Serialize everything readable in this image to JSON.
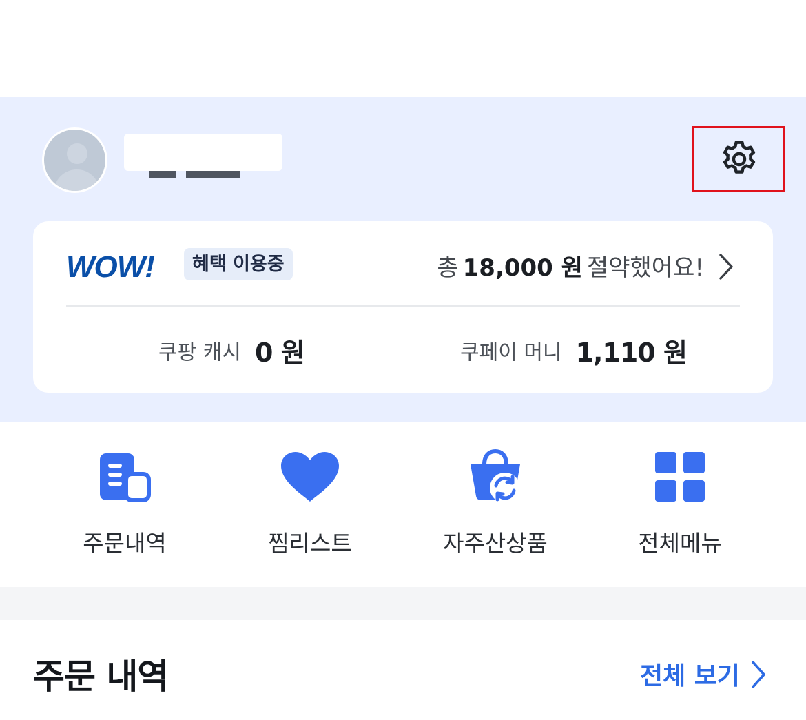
{
  "profile": {
    "avatar_icon": "user-avatar-placeholder"
  },
  "settings": {
    "icon": "gear-icon"
  },
  "membership": {
    "logo_text": "WOW!",
    "badge": "혜택 이용중",
    "savings_prefix": "총",
    "savings_amount": "18,000 원",
    "savings_suffix": "절약했어요!"
  },
  "wallet": {
    "cash_label": "쿠팡 캐시",
    "cash_value": "0 원",
    "pay_label": "쿠페이 머니",
    "pay_value": "1,110 원"
  },
  "quick_menu": [
    {
      "label": "주문내역",
      "icon": "receipt-icon"
    },
    {
      "label": "찜리스트",
      "icon": "heart-icon"
    },
    {
      "label": "자주산상품",
      "icon": "repurchase-bag-icon"
    },
    {
      "label": "전체메뉴",
      "icon": "grid-icon"
    }
  ],
  "orders": {
    "title": "주문 내역",
    "view_all": "전체 보기"
  },
  "colors": {
    "header_bg": "#e9efff",
    "accent_blue": "#3a6ff0",
    "wow_blue": "#0a4fa8",
    "highlight_red": "#e0121c"
  }
}
